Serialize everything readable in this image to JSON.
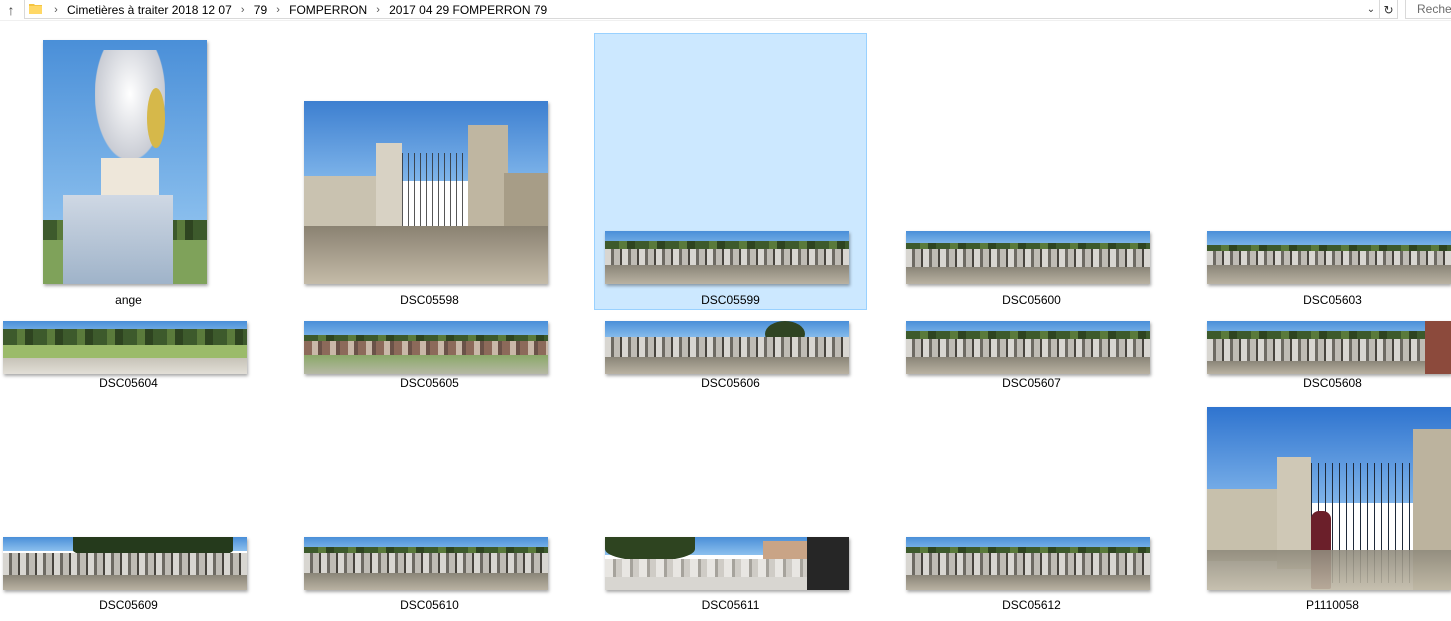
{
  "address_bar": {
    "breadcrumbs": [
      "Cimetières à traiter 2018 12 07",
      "79",
      "FOMPERRON",
      "2017 04 29 FOMPERRON 79"
    ],
    "search_placeholder": "Recher"
  },
  "icons": {
    "up": "arrow-up-icon",
    "folder": "folder-icon",
    "separator": "chevron-right-icon",
    "dropdown": "chevron-down-icon",
    "refresh": "refresh-icon"
  },
  "colors": {
    "selection_bg": "#cce8ff",
    "selection_border": "#99d1ff"
  },
  "files": [
    {
      "name": "ange",
      "kind": "portrait"
    },
    {
      "name": "DSC05598",
      "kind": "landscape"
    },
    {
      "name": "DSC05599",
      "kind": "panorama",
      "selected": true
    },
    {
      "name": "DSC05600",
      "kind": "panorama"
    },
    {
      "name": "DSC05603",
      "kind": "panorama"
    },
    {
      "name": "DSC05604",
      "kind": "panorama"
    },
    {
      "name": "DSC05605",
      "kind": "panorama"
    },
    {
      "name": "DSC05606",
      "kind": "panorama"
    },
    {
      "name": "DSC05607",
      "kind": "panorama"
    },
    {
      "name": "DSC05608",
      "kind": "panorama"
    },
    {
      "name": "DSC05609",
      "kind": "panorama"
    },
    {
      "name": "DSC05610",
      "kind": "panorama"
    },
    {
      "name": "DSC05611",
      "kind": "panorama"
    },
    {
      "name": "DSC05612",
      "kind": "panorama"
    },
    {
      "name": "P1110058",
      "kind": "landscape"
    }
  ]
}
